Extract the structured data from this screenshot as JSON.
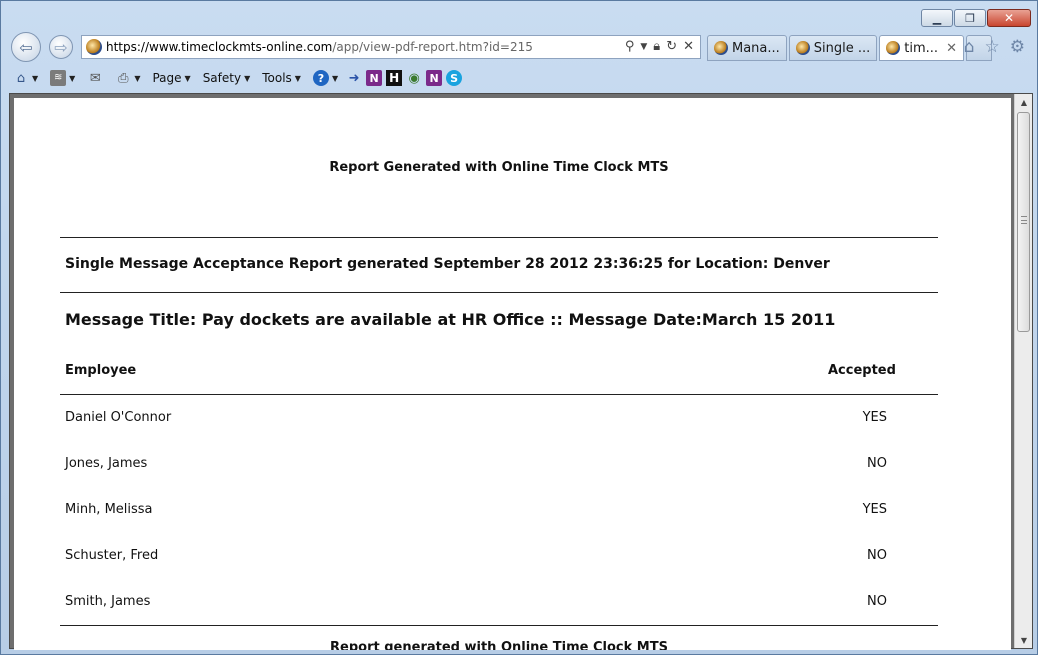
{
  "browser": {
    "url_host": "https://www.timeclockmts-online.com",
    "url_rest": "/app/view-pdf-report.htm?id=215",
    "tabs": [
      {
        "label": "Mana...",
        "active": false
      },
      {
        "label": "Single ...",
        "active": false
      },
      {
        "label": "tim...",
        "active": true
      }
    ],
    "command_bar": {
      "page": "Page",
      "safety": "Safety",
      "tools": "Tools"
    }
  },
  "report": {
    "header": "Report Generated with Online Time Clock MTS",
    "title": "Single Message Acceptance Report generated September 28 2012 23:36:25 for Location: Denver",
    "message_line": "Message Title: Pay dockets are available at HR Office :: Message Date:March 15 2011",
    "columns": {
      "employee": "Employee",
      "accepted": "Accepted"
    },
    "rows": [
      {
        "name": "Daniel O'Connor",
        "accepted": "YES"
      },
      {
        "name": "Jones, James",
        "accepted": "NO"
      },
      {
        "name": "Minh, Melissa",
        "accepted": "YES"
      },
      {
        "name": "Schuster, Fred",
        "accepted": "NO"
      },
      {
        "name": "Smith, James",
        "accepted": "NO"
      }
    ],
    "footer": "Report generated with Online Time Clock MTS"
  },
  "colors": {
    "frame": "#b9d1ea",
    "viewport_bg": "#6e6e6e",
    "page_bg": "#ffffff",
    "close_button": "#c9452f"
  }
}
